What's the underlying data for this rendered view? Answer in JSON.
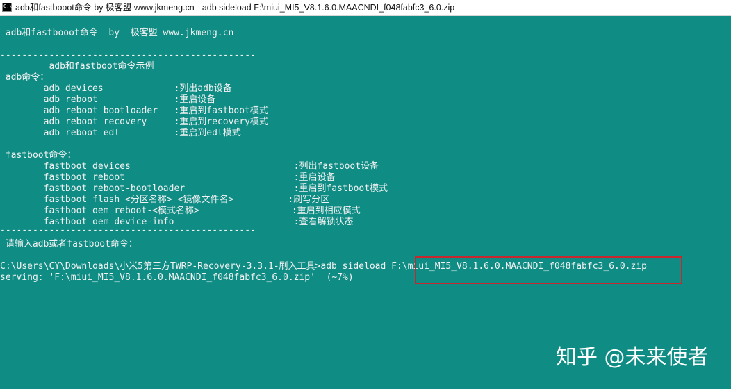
{
  "window": {
    "title": "adb和fastbooot命令  by  极客盟 www.jkmeng.cn - adb  sideload F:\\miui_MI5_V8.1.6.0.MAACNDI_f048fabfc3_6.0.zip",
    "icon_label": "C:\\",
    "background_color": "#0f8c84",
    "text_color": "#f2f2f2",
    "highlight_color": "#c8282d"
  },
  "console": {
    "header": " adb和fastbooot命令  by  极客盟 www.jkmeng.cn",
    "separator_top": "-----------------------------------------------",
    "section_title": "         adb和fastboot命令示例",
    "adb_heading": " adb命令：",
    "adb_commands": [
      {
        "cmd": "        adb devices             ",
        "desc": ":列出adb设备"
      },
      {
        "cmd": "        adb reboot              ",
        "desc": ":重启设备"
      },
      {
        "cmd": "        adb reboot bootloader   ",
        "desc": ":重启到fastboot模式"
      },
      {
        "cmd": "        adb reboot recovery     ",
        "desc": ":重启到recovery模式"
      },
      {
        "cmd": "        adb reboot edl          ",
        "desc": ":重启到edl模式"
      }
    ],
    "fastboot_heading": " fastboot命令：",
    "fastboot_commands": [
      {
        "cmd": "        fastboot devices                              ",
        "desc": ":列出fastboot设备"
      },
      {
        "cmd": "        fastboot reboot                               ",
        "desc": ":重启设备"
      },
      {
        "cmd": "        fastboot reboot-bootloader                    ",
        "desc": ":重启到fastboot模式"
      },
      {
        "cmd": "        fastboot flash <分区名称> <镜像文件名>          ",
        "desc": ":刷写分区"
      },
      {
        "cmd": "        fastboot oem reboot-<模式名称>                 ",
        "desc": ":重启到相应模式"
      },
      {
        "cmd": "        fastboot oem device-info                      ",
        "desc": ":查看解锁状态"
      }
    ],
    "separator_bottom": "-----------------------------------------------",
    "input_prompt": " 请输入adb或者fastboot命令：",
    "command_prompt": "C:\\Users\\CY\\Downloads\\小米5第三方TWRP-Recovery-3.3.1-刷入工具>",
    "command_entered": "adb sideload ",
    "command_file": "F:\\miui_MI5_V8.1.6.0.MAACNDI_f048fabfc3_6.0.zip",
    "serving_status": "serving: 'F:\\miui_MI5_V8.1.6.0.MAACNDI_f048fabfc3_6.0.zip'  (~7%)"
  },
  "watermark": {
    "text": "知乎 @未来使者"
  }
}
